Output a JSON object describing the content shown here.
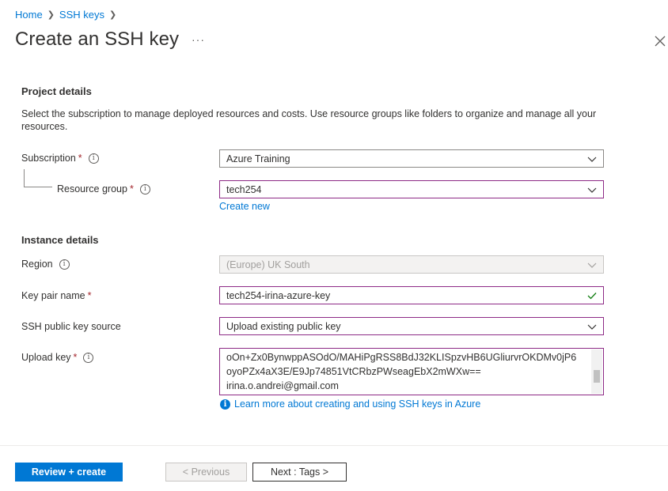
{
  "breadcrumb": {
    "items": [
      "Home",
      "SSH keys"
    ]
  },
  "page": {
    "title": "Create an SSH key",
    "more": "···"
  },
  "project": {
    "title": "Project details",
    "description": "Select the subscription to manage deployed resources and costs. Use resource groups like folders to organize and manage all your resources.",
    "subscription_label": "Subscription",
    "subscription_value": "Azure Training",
    "resource_group_label": "Resource group",
    "resource_group_value": "tech254",
    "create_new": "Create new"
  },
  "instance": {
    "title": "Instance details",
    "region_label": "Region",
    "region_value": "(Europe) UK South",
    "key_pair_label": "Key pair name",
    "key_pair_value": "tech254-irina-azure-key",
    "source_label": "SSH public key source",
    "source_value": "Upload existing public key",
    "upload_label": "Upload key",
    "upload_lines": [
      "oOn+Zx0BynwppASOdO/MAHiPgRSS8BdJ32KLISpzvHB6UGliurvrOKDMv0jP6",
      "oyoPZx4aX3E/E9Jp74851VtCRbzPWseagEbX2mWXw==",
      "irina.o.andrei@gmail.com"
    ],
    "learn_more": "Learn more about creating and using SSH keys in Azure"
  },
  "footer": {
    "review_create": "Review + create",
    "previous": "< Previous",
    "next": "Next : Tags >"
  },
  "colors": {
    "accent": "#0078d4",
    "required": "#a4262c",
    "valid_border": "#8d2a86",
    "success": "#107c10"
  }
}
